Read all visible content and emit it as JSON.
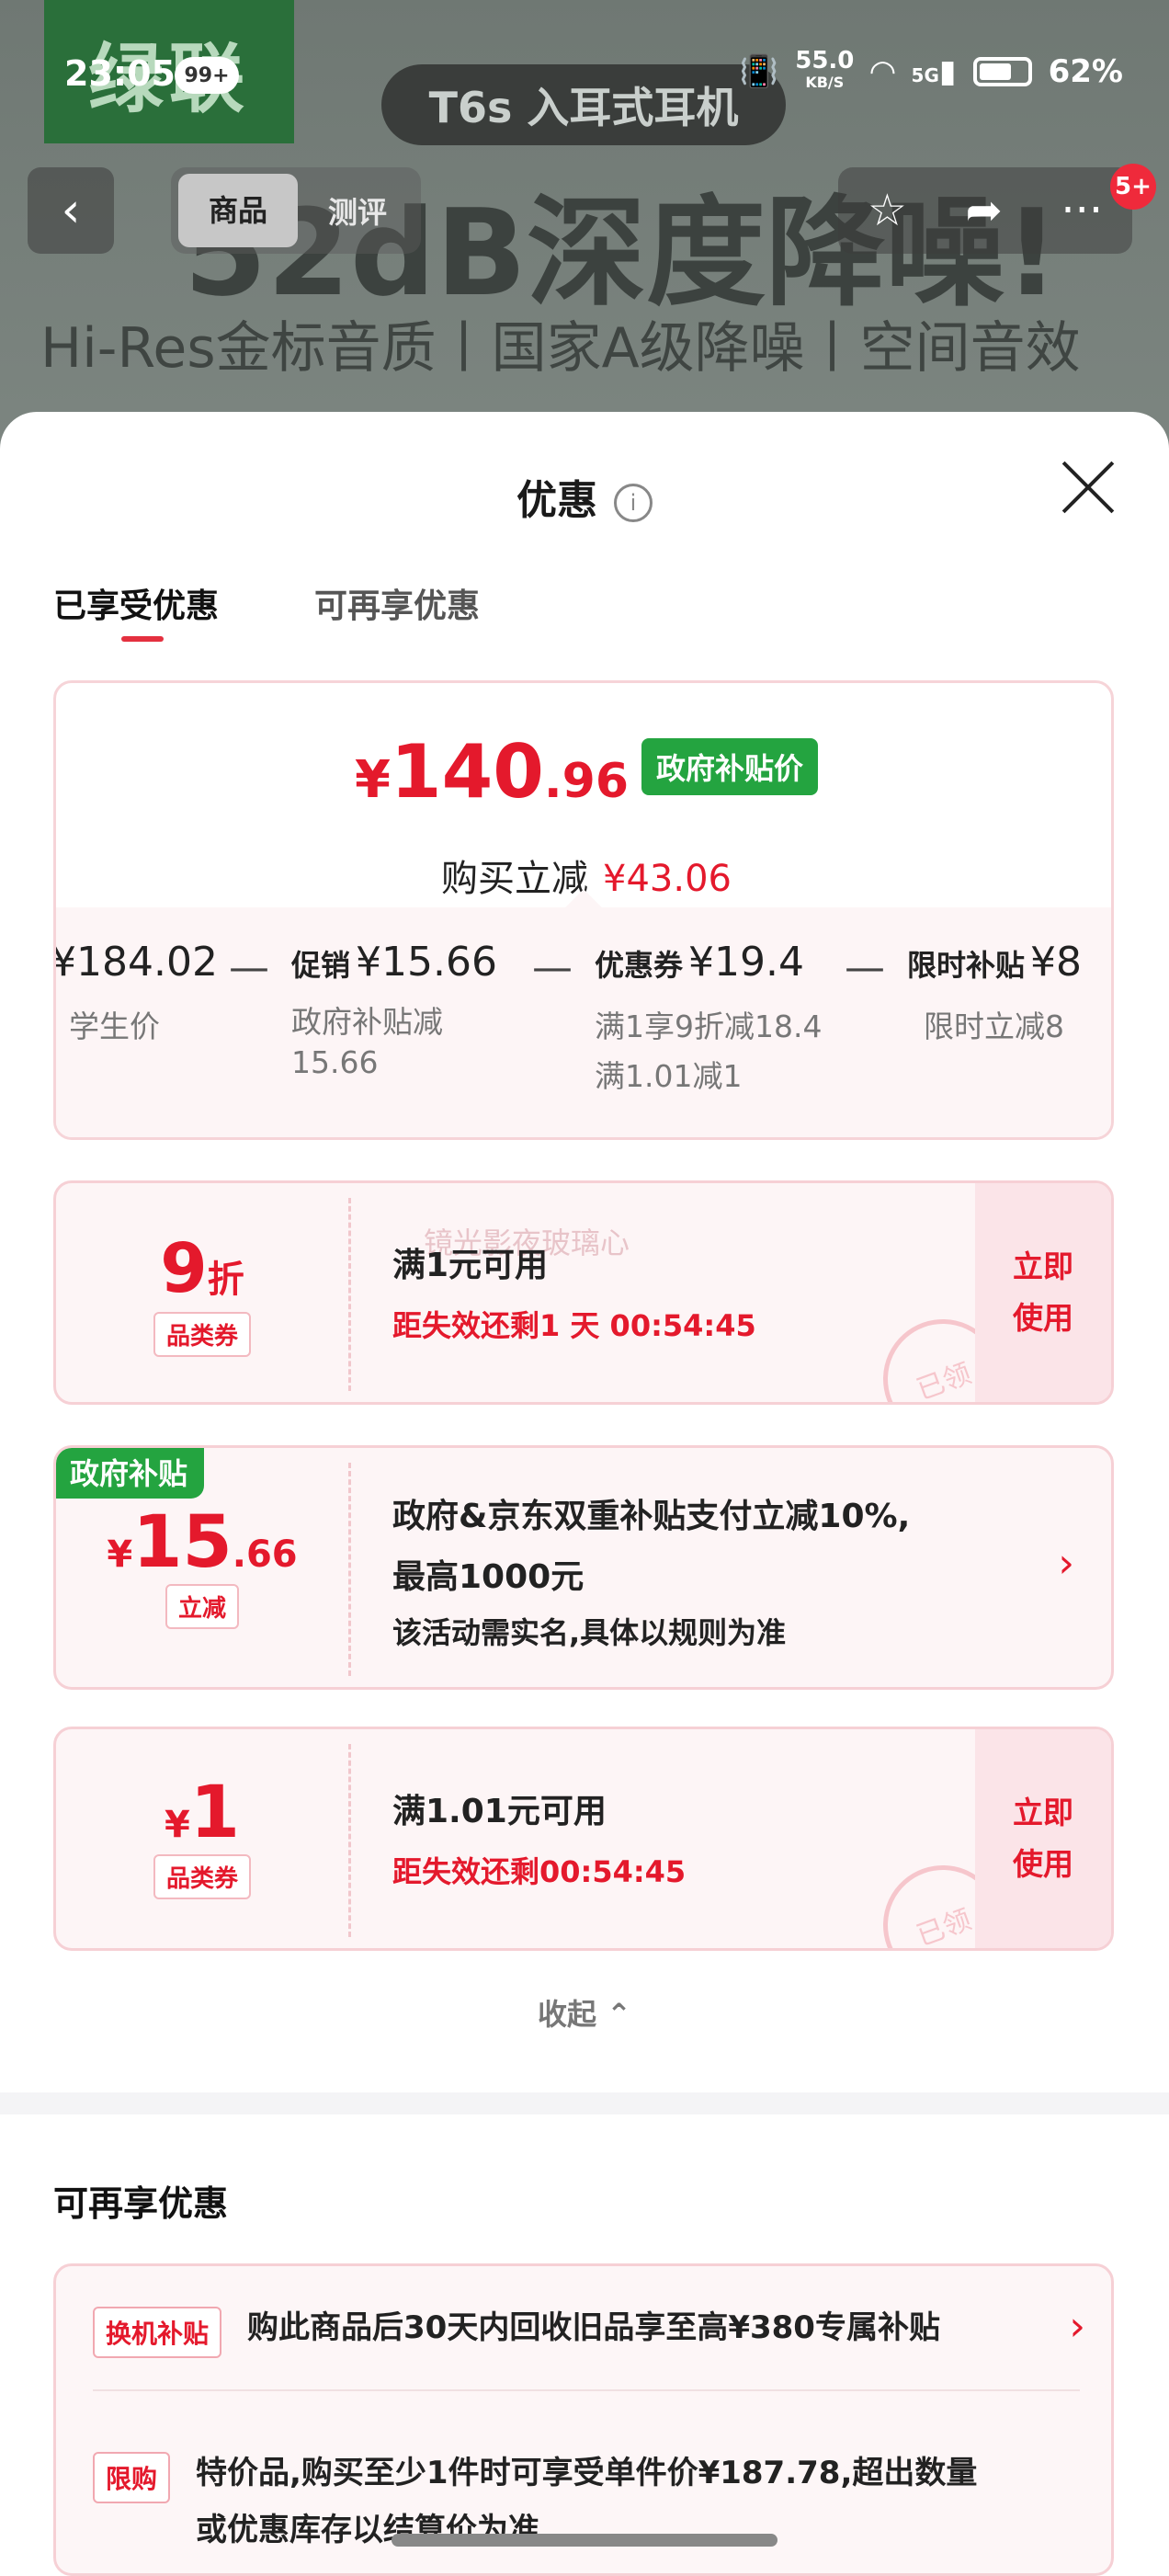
{
  "status_bar": {
    "time": "23:05",
    "notification_badge": "99+",
    "net_speed": "55.0",
    "net_unit": "KB/S",
    "network": "5G",
    "battery": "62%"
  },
  "background": {
    "brand": "绿联",
    "product": "T6s 入耳式耳机",
    "headline": "52dB深度降噪!",
    "subline": "Hi-Res金标音质丨国家A级降噪丨空间音效"
  },
  "nav": {
    "back": "‹",
    "tabs": [
      "商品",
      "测评"
    ],
    "cart_badge": "5+"
  },
  "sheet": {
    "title": "优惠",
    "info_icon": "i",
    "tabs": [
      "已享受优惠",
      "可再享优惠"
    ],
    "summary": {
      "currency": "¥",
      "price_int": "140",
      "price_dec": ".96",
      "gov_tag": "政府补贴价",
      "reduce_label": "购买立减",
      "reduce_value": "¥43.06",
      "breakdown": [
        {
          "label": "",
          "value": "¥184.02",
          "desc": "学生价",
          "desc2": ""
        },
        {
          "label": "促销",
          "value": "¥15.66",
          "desc": "政府补贴减",
          "desc2": "15.66"
        },
        {
          "label": "优惠券",
          "value": "¥19.4",
          "desc": "满1享9折减18.4",
          "desc2": "满1.01减1"
        },
        {
          "label": "限时补贴",
          "value": "¥8",
          "desc": "限时立减8",
          "desc2": ""
        }
      ],
      "minus": "—"
    },
    "coupons": [
      {
        "amount": "9",
        "unit": "折",
        "type": "品类券",
        "title": "满1元可用",
        "sub": "距失效还剩1 天 00:54:45",
        "use": [
          "立即",
          "使用"
        ],
        "stamp": "已领",
        "watermark": "镜光影夜玻璃心"
      },
      {
        "corner": "政府补贴",
        "currency": "¥",
        "amount": "15",
        "dec": ".66",
        "type": "立减",
        "title": "政府&京东双重补贴支付立减10%,",
        "title2": "最高1000元",
        "sub": "该活动需实名,具体以规则为准",
        "chevron": "›"
      },
      {
        "currency": "¥",
        "amount": "1",
        "type": "品类券",
        "title": "满1.01元可用",
        "sub": "距失效还剩00:54:45",
        "use": [
          "立即",
          "使用"
        ],
        "stamp": "已领"
      }
    ],
    "collapse": "收起",
    "more_title": "可再享优惠",
    "more_items": [
      {
        "tag": "换机补贴",
        "text": "购此商品后30天内回收旧品享至高¥380专属补贴",
        "chevron": "›"
      },
      {
        "tag": "限购",
        "text": "特价品,购买至少1件时可享受单件价¥187.78,超出数量",
        "text2": "或优惠库存以结算价为准"
      }
    ]
  }
}
